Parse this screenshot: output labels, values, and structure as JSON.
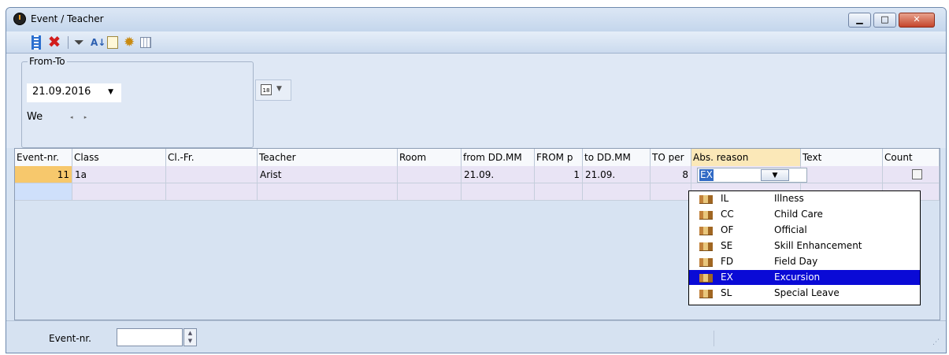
{
  "window": {
    "title": "Event / Teacher"
  },
  "toolbar": {
    "icons": [
      "list-icon",
      "delete-icon",
      "filter-icon",
      "sort-icon",
      "document-settings-icon",
      "gear-icon",
      "grid-icon"
    ]
  },
  "filter": {
    "group_label": "From-To",
    "date": "21.09.2016",
    "weekday": "We",
    "spin": "◂ ▸"
  },
  "grid": {
    "columns": [
      "Event-nr.",
      "Class",
      "Cl.-Fr.",
      "Teacher",
      "Room",
      "from DD.MM",
      "FROM p",
      "to DD.MM",
      "TO per",
      "Abs. reason",
      "Text",
      "Count"
    ],
    "rows": [
      {
        "event_nr": "11",
        "class": "1a",
        "cl_fr": "",
        "teacher": "Arist",
        "room": "",
        "from_date": "21.09.",
        "from_period": "1",
        "to_date": "21.09.",
        "to_period": "8",
        "abs_reason": "EX",
        "text": "",
        "count": false
      }
    ]
  },
  "abs_reason_options": [
    {
      "code": "IL",
      "name": "Illness"
    },
    {
      "code": "CC",
      "name": "Child Care"
    },
    {
      "code": "OF",
      "name": "Official"
    },
    {
      "code": "SE",
      "name": "Skill Enhancement"
    },
    {
      "code": "FD",
      "name": "Field Day"
    },
    {
      "code": "EX",
      "name": "Excursion",
      "selected": true
    },
    {
      "code": "SL",
      "name": "Special Leave"
    }
  ],
  "status": {
    "label": "Event-nr.",
    "value": ""
  },
  "colors": {
    "selected_item": "#0a0ad6",
    "header_highlight": "#fbe8b8",
    "row_bg": "#e9e4f5"
  }
}
